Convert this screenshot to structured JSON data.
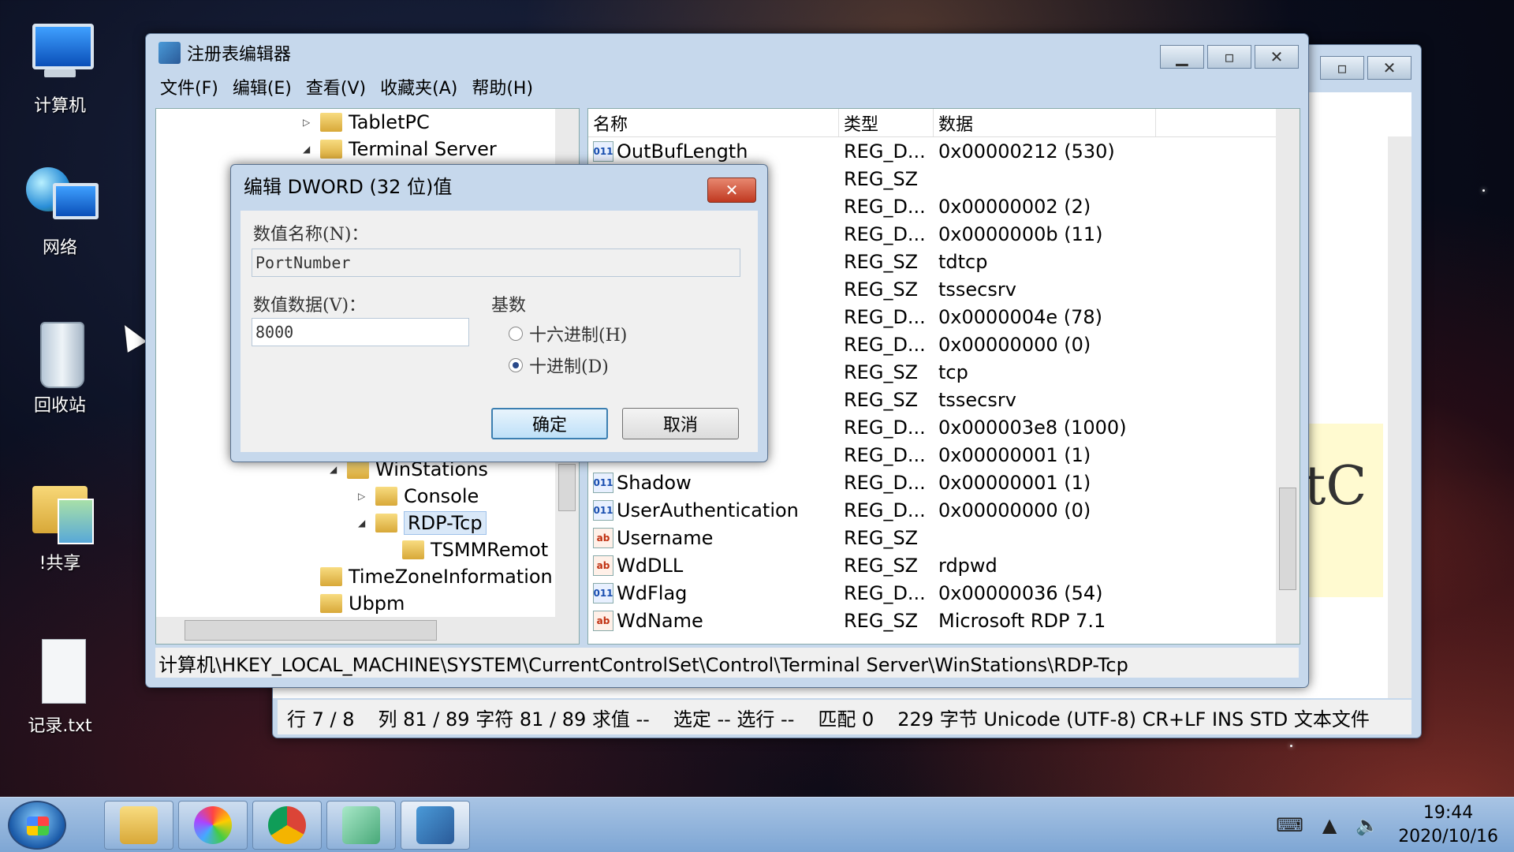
{
  "desktop": {
    "icons": [
      {
        "label": "计算机"
      },
      {
        "label": "网络"
      },
      {
        "label": "回收站"
      },
      {
        "label": "!共享"
      },
      {
        "label": "记录.txt"
      }
    ]
  },
  "notepad": {
    "fragment": "tC",
    "status": {
      "line": "行 7 / 8",
      "col": "列 81 / 89 字符 81 / 89 求值 --",
      "sel": "选定 -- 选行 --",
      "match": "匹配 0",
      "size": "229 字节 Unicode (UTF-8) CR+LF INS STD 文本文件"
    }
  },
  "regedit": {
    "title": "注册表编辑器",
    "menu": [
      "文件(F)",
      "编辑(E)",
      "查看(V)",
      "收藏夹(A)",
      "帮助(H)"
    ],
    "tree": [
      {
        "label": "TabletPC",
        "tw": "▷"
      },
      {
        "label": "Terminal Server",
        "tw": "◢"
      },
      {
        "label": "WinStations",
        "tw": "◢"
      },
      {
        "label": "Console",
        "tw": "▷"
      },
      {
        "label": "RDP-Tcp",
        "tw": "◢"
      },
      {
        "label": "TSMMRemot",
        "tw": ""
      },
      {
        "label": "TimeZoneInformation",
        "tw": ""
      },
      {
        "label": "Ubpm",
        "tw": ""
      }
    ],
    "columns": {
      "name": "名称",
      "type": "类型",
      "data": "数据"
    },
    "rows": [
      {
        "name": "OutBufLength",
        "type": "REG_D...",
        "data": "0x00000212 (530)",
        "icon": "bin"
      },
      {
        "name": "",
        "type": "REG_SZ",
        "data": "",
        "icon": ""
      },
      {
        "name": "",
        "type": "REG_D...",
        "data": "0x00000002 (2)",
        "icon": ""
      },
      {
        "name": "",
        "type": "REG_D...",
        "data": "0x0000000b (11)",
        "icon": ""
      },
      {
        "name": "",
        "type": "REG_SZ",
        "data": "tdtcp",
        "icon": ""
      },
      {
        "name": "",
        "type": "REG_SZ",
        "data": "tssecsrv",
        "icon": ""
      },
      {
        "name": "",
        "type": "REG_D...",
        "data": "0x0000004e (78)",
        "icon": ""
      },
      {
        "name": "",
        "type": "REG_D...",
        "data": "0x00000000 (0)",
        "icon": ""
      },
      {
        "name": "",
        "type": "REG_SZ",
        "data": "tcp",
        "icon": ""
      },
      {
        "name": "",
        "type": "REG_SZ",
        "data": "tssecsrv",
        "icon": ""
      },
      {
        "name": "",
        "type": "REG_D...",
        "data": "0x000003e8 (1000)",
        "icon": ""
      },
      {
        "name": "",
        "type": "REG_D...",
        "data": "0x00000001 (1)",
        "icon": ""
      },
      {
        "name": "Shadow",
        "type": "REG_D...",
        "data": "0x00000001 (1)",
        "icon": "bin"
      },
      {
        "name": "UserAuthentication",
        "type": "REG_D...",
        "data": "0x00000000 (0)",
        "icon": "bin"
      },
      {
        "name": "Username",
        "type": "REG_SZ",
        "data": "",
        "icon": "str"
      },
      {
        "name": "WdDLL",
        "type": "REG_SZ",
        "data": "rdpwd",
        "icon": "str"
      },
      {
        "name": "WdFlag",
        "type": "REG_D...",
        "data": "0x00000036 (54)",
        "icon": "bin"
      },
      {
        "name": "WdName",
        "type": "REG_SZ",
        "data": "Microsoft RDP 7.1",
        "icon": "str"
      }
    ],
    "address": "计算机\\HKEY_LOCAL_MACHINE\\SYSTEM\\CurrentControlSet\\Control\\Terminal Server\\WinStations\\RDP-Tcp"
  },
  "dialog": {
    "title": "编辑 DWORD (32 位)值",
    "name_label": "数值名称(N)：",
    "name_value": "PortNumber",
    "data_label": "数值数据(V)：",
    "data_value": "8000",
    "base_label": "基数",
    "hex_label": "十六进制(H)",
    "dec_label": "十进制(D)",
    "selected_base": "十进制(D)",
    "ok_label": "确定",
    "cancel_label": "取消"
  },
  "taskbar": {
    "time": "19:44",
    "date": "2020/10/16",
    "apps": [
      "file-explorer",
      "browser-colorful",
      "chrome",
      "notepad-editor",
      "regedit"
    ]
  }
}
